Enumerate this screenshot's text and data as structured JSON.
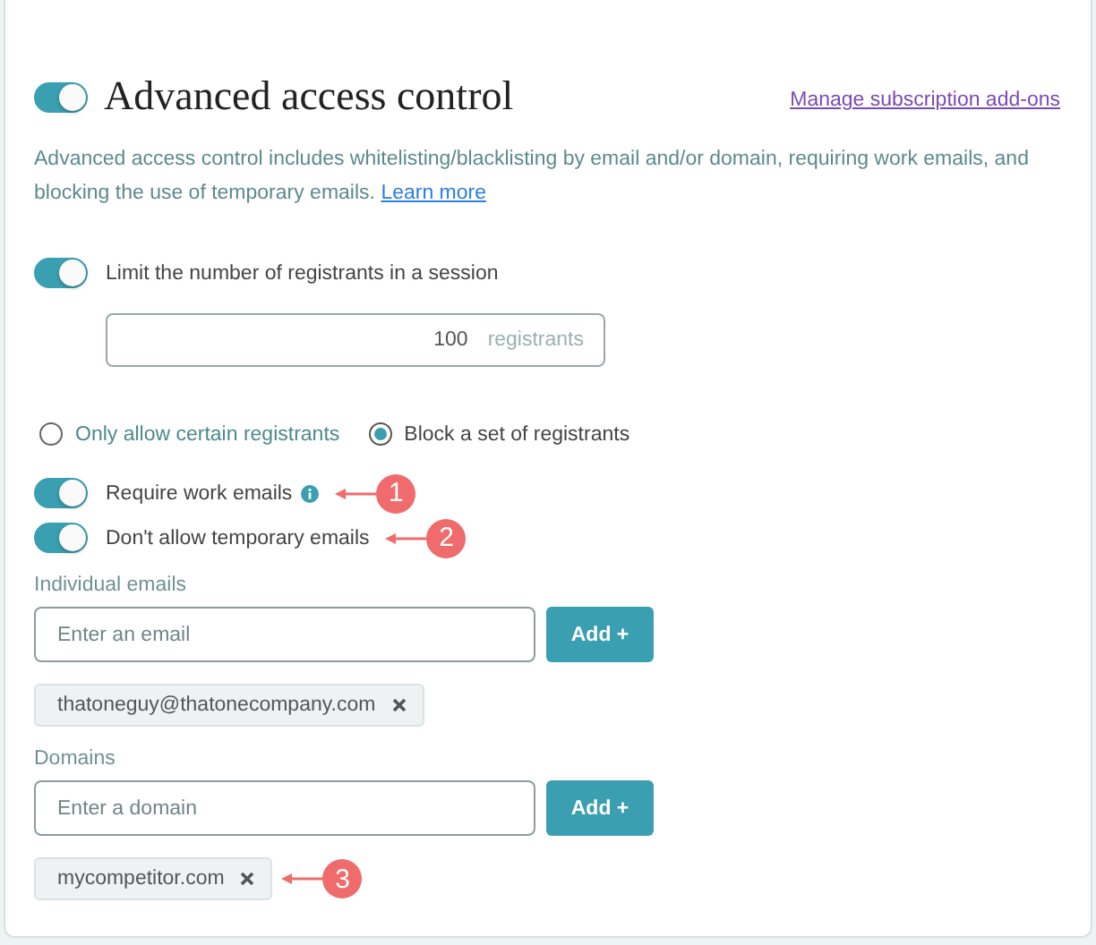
{
  "header": {
    "on": true,
    "title": "Advanced access control",
    "link": "Manage subscription add-ons"
  },
  "description": {
    "text": "Advanced access control includes whitelisting/blacklisting by email and/or domain, requiring work emails, and blocking the use of temporary emails.",
    "link": "Learn more"
  },
  "limit": {
    "on": true,
    "label": "Limit the number of registrants in a session",
    "value": "100",
    "unit": "registrants"
  },
  "modes": [
    {
      "label": "Only allow certain registrants",
      "selected": false
    },
    {
      "label": "Block a set of registrants",
      "selected": true
    }
  ],
  "options": [
    {
      "label": "Require work emails",
      "on": true,
      "info": true,
      "callout": "1"
    },
    {
      "label": "Don't allow temporary emails",
      "on": true,
      "callout": "2"
    }
  ],
  "lists": [
    {
      "label": "Individual emails",
      "placeholder": "Enter an email",
      "button": "Add +",
      "chips": [
        {
          "text": "thatoneguy@thatonecompany.com"
        }
      ]
    },
    {
      "label": "Domains",
      "placeholder": "Enter a domain",
      "button": "Add +",
      "chips": [
        {
          "text": "mycompetitor.com",
          "callout": "3"
        }
      ]
    }
  ]
}
